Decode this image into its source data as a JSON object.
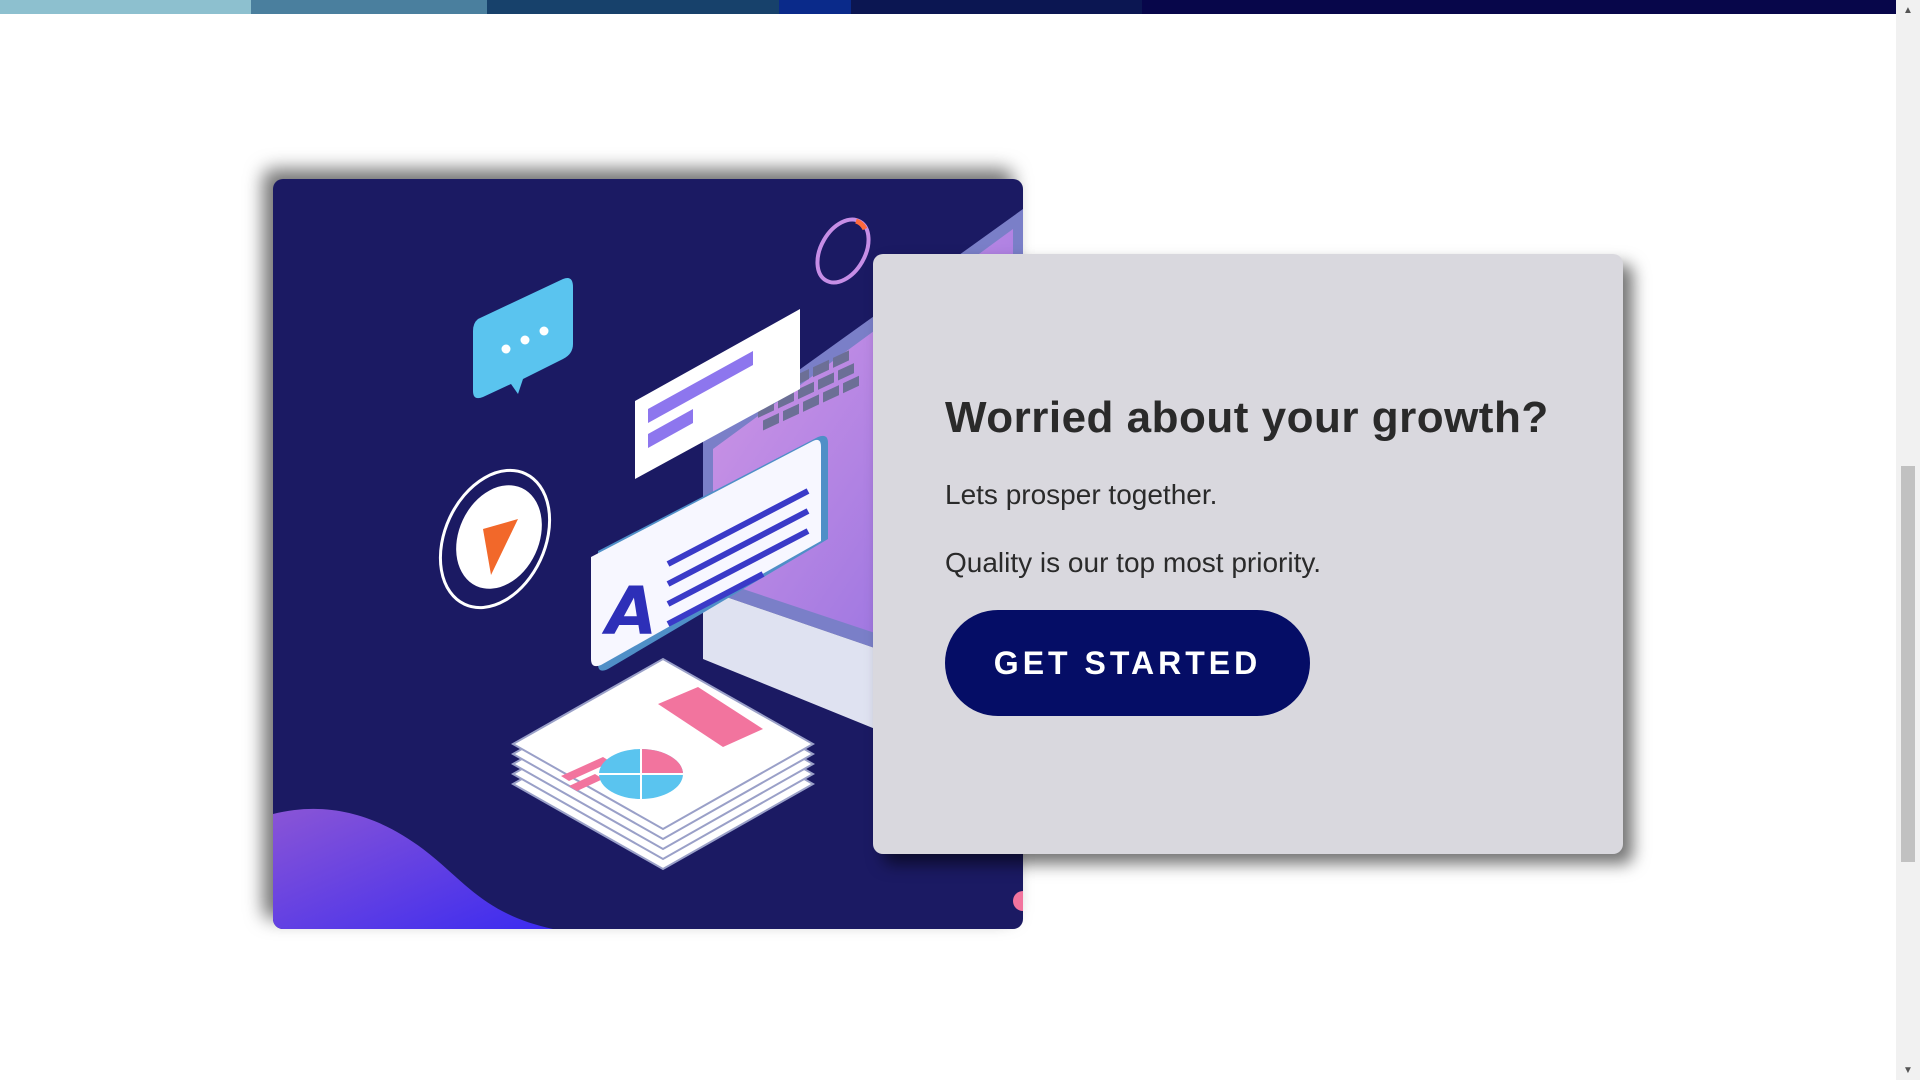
{
  "top_strip": {
    "colors": [
      "#8dc0cf",
      "#4a7f9e",
      "#17416b",
      "#0a2a8a",
      "#0b1652",
      "#07064a"
    ]
  },
  "hero": {
    "heading": "Worried about your growth?",
    "line1": "Lets prosper together.",
    "line2": "Quality is our top most priority.",
    "cta_label": "GET STARTED",
    "cta_color": "#050d66",
    "card_bg": "#d9d8de"
  },
  "illustration": {
    "bg_color": "#1b1a63",
    "icons": [
      "chat-bubble-icon",
      "play-icon",
      "document-a-icon",
      "laptop-icon",
      "report-stack-icon",
      "loading-ring-icon"
    ],
    "document_letter": "A"
  },
  "scrollbar": {
    "up_icon": "▲",
    "down_icon": "▼"
  }
}
